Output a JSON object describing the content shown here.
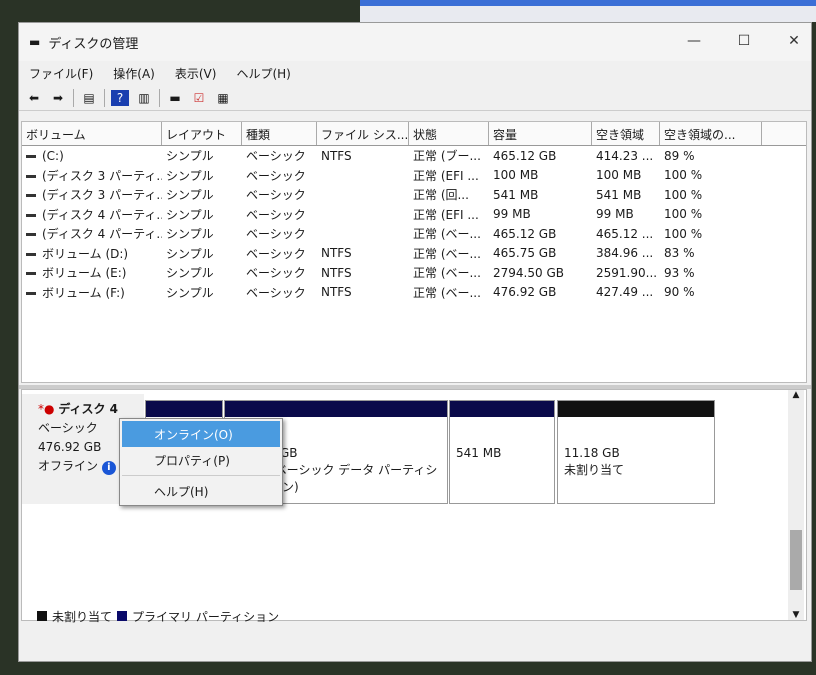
{
  "window": {
    "title": "ディスクの管理",
    "minimize": "—",
    "maximize": "☐",
    "close": "✕"
  },
  "menu": [
    "ファイル(F)",
    "操作(A)",
    "表示(V)",
    "ヘルプ(H)"
  ],
  "toolbar_icons": [
    "back-icon",
    "forward-icon",
    "console-tree-icon",
    "help-icon",
    "action-pane-icon",
    "disk-icon",
    "check-document-icon",
    "properties-icon"
  ],
  "columns": [
    "ボリューム",
    "レイアウト",
    "種類",
    "ファイル シス...",
    "状態",
    "容量",
    "空き領域",
    "空き領域の..."
  ],
  "volumes": [
    [
      "(C:)",
      "シンプル",
      "ベーシック",
      "NTFS",
      "正常 (ブー...",
      "465.12 GB",
      "414.23 ...",
      "89 %"
    ],
    [
      "(ディスク 3 パーティ...",
      "シンプル",
      "ベーシック",
      "",
      "正常 (EFI ...",
      "100 MB",
      "100 MB",
      "100 %"
    ],
    [
      "(ディスク 3 パーティ...",
      "シンプル",
      "ベーシック",
      "",
      "正常 (回...",
      "541 MB",
      "541 MB",
      "100 %"
    ],
    [
      "(ディスク 4 パーティ...",
      "シンプル",
      "ベーシック",
      "",
      "正常 (EFI ...",
      "99 MB",
      "99 MB",
      "100 %"
    ],
    [
      "(ディスク 4 パーティ...",
      "シンプル",
      "ベーシック",
      "",
      "正常 (ベー...",
      "465.12 GB",
      "465.12 ...",
      "100 %"
    ],
    [
      "ボリューム (D:)",
      "シンプル",
      "ベーシック",
      "NTFS",
      "正常 (ベー...",
      "465.75 GB",
      "384.96 ...",
      "83 %"
    ],
    [
      "ボリューム (E:)",
      "シンプル",
      "ベーシック",
      "NTFS",
      "正常 (ベー...",
      "2794.50 GB",
      "2591.90...",
      "93 %"
    ],
    [
      "ボリューム (F:)",
      "シンプル",
      "ベーシック",
      "NTFS",
      "正常 (ベー...",
      "476.92 GB",
      "427.49 ...",
      "90 %"
    ]
  ],
  "disk": {
    "name": "ディスク 4",
    "type": "ベーシック",
    "size": "476.92 GB",
    "status": "オフライン",
    "info": "i"
  },
  "partitions": [
    {
      "line1": "",
      "line2": ""
    },
    {
      "line1": "GB",
      "line2": "(ベーシック データ パーティション)"
    },
    {
      "line1": "541 MB",
      "line2": ""
    },
    {
      "line1": "11.18 GB",
      "line2": "未割り当て"
    }
  ],
  "context_menu": [
    "オンライン(O)",
    "プロパティ(P)",
    "ヘルプ(H)"
  ],
  "legend": [
    {
      "label": "未割り当て",
      "color": "#111111"
    },
    {
      "label": "プライマリ パーティション",
      "color": "#0a0a6a"
    }
  ],
  "colors": {
    "primary": "#0a0a4a",
    "unallocated": "#111111",
    "highlight": "#4a9be0"
  }
}
